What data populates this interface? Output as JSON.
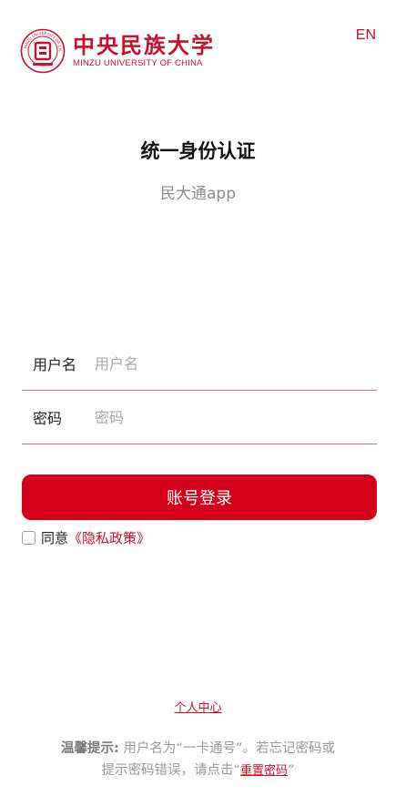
{
  "header": {
    "logo_cn": "中央民族大学",
    "logo_en": "MINZU UNIVERSITY OF CHINA",
    "seal_text": "MINZU UNIVERSITY OF CHINA",
    "lang_switch": "EN"
  },
  "title": "统一身份认证",
  "subtitle": "民大通app",
  "form": {
    "username_label": "用户名",
    "username_placeholder": "用户名",
    "password_label": "密码",
    "password_placeholder": "密码",
    "login_button": "账号登录"
  },
  "agreement": {
    "text": "同意",
    "policy_link": "《隐私政策》",
    "checked": false
  },
  "personal_center": "个人中心",
  "tip": {
    "label": "温馨提示:",
    "line1": "用户名为“一卡通号”。若忘记密码或",
    "line2": "提示密码错误，请点击“",
    "reset_link": "重置密码",
    "line2_end": "”"
  },
  "colors": {
    "brand": "#c8102e",
    "button": "#d6001c"
  }
}
